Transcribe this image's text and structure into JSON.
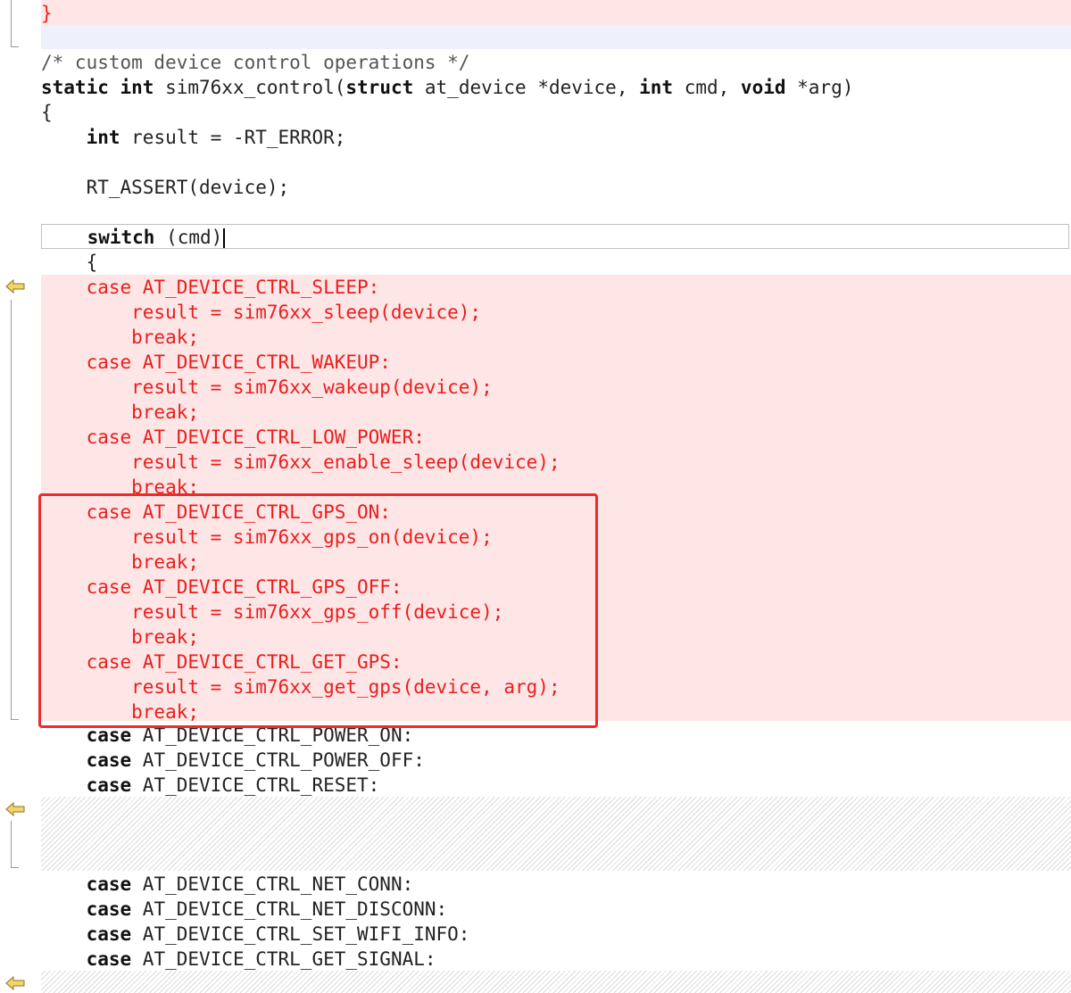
{
  "colors": {
    "deleted_bg": "#ffe6e6",
    "deleted_text": "#ea1d1d",
    "highlight_border": "#ee2b2b"
  },
  "gutter_markers": [
    "change-arrow-icon",
    "change-arrow-icon",
    "change-arrow-icon"
  ],
  "code": {
    "closing_brace": "}",
    "comment": "/* custom device control operations */",
    "sig_kw1": "static",
    "sig_sp1": " ",
    "sig_kw2": "int",
    "sig_mid1": " sim76xx_control(",
    "sig_kw3": "struct",
    "sig_mid2": " at_device *device, ",
    "sig_kw4": "int",
    "sig_mid3": " cmd, ",
    "sig_kw5": "void",
    "sig_end": " *arg)",
    "open_brace": "{",
    "result_indent": "    ",
    "result_kw": "int",
    "result_rest": " result = -RT_ERROR;",
    "assert_line": "    RT_ASSERT(device);",
    "switch_indent": "    ",
    "switch_kw": "switch",
    "switch_rest": " (cmd)",
    "switch_brace": "    {",
    "deleted_lines": [
      "    case AT_DEVICE_CTRL_SLEEP:",
      "        result = sim76xx_sleep(device);",
      "        break;",
      "    case AT_DEVICE_CTRL_WAKEUP:",
      "        result = sim76xx_wakeup(device);",
      "        break;",
      "    case AT_DEVICE_CTRL_LOW_POWER:",
      "        result = sim76xx_enable_sleep(device);",
      "        break;",
      "    case AT_DEVICE_CTRL_GPS_ON:",
      "        result = sim76xx_gps_on(device);",
      "        break;",
      "    case AT_DEVICE_CTRL_GPS_OFF:",
      "        result = sim76xx_gps_off(device);",
      "        break;",
      "    case AT_DEVICE_CTRL_GET_GPS:",
      "        result = sim76xx_get_gps(device, arg);",
      "        break;"
    ],
    "case_kw": "case",
    "case_group1": [
      " AT_DEVICE_CTRL_POWER_ON:",
      " AT_DEVICE_CTRL_POWER_OFF:",
      " AT_DEVICE_CTRL_RESET:"
    ],
    "case_group2": [
      " AT_DEVICE_CTRL_NET_CONN:",
      " AT_DEVICE_CTRL_NET_DISCONN:",
      " AT_DEVICE_CTRL_SET_WIFI_INFO:",
      " AT_DEVICE_CTRL_GET_SIGNAL:"
    ]
  }
}
